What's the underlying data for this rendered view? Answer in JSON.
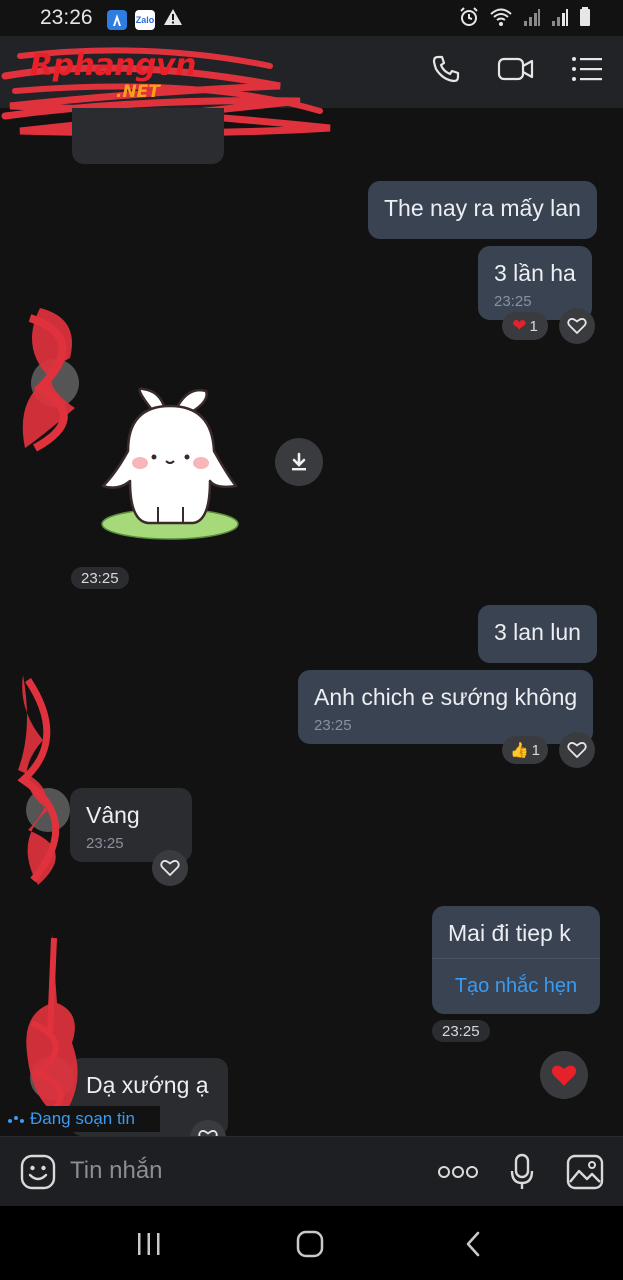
{
  "status_bar": {
    "time": "23:26",
    "left_icons": [
      "app-icon",
      "zalo-icon",
      "warning-icon"
    ],
    "zalo_label": "Zalo",
    "right_icons": [
      "alarm-icon",
      "wifi-icon",
      "signal-icon",
      "signal-icon",
      "battery-icon"
    ]
  },
  "header": {
    "watermark_brand": "Rphangvn",
    "watermark_suffix": ".NET",
    "actions": [
      "phone-icon",
      "video-call-icon",
      "menu-icon"
    ]
  },
  "messages": [
    {
      "id": "m1",
      "direction": "out",
      "text": "The nay ra mấy lan"
    },
    {
      "id": "m2",
      "direction": "out",
      "text": "3 lần ha",
      "time": "23:25",
      "reaction": {
        "emoji": "❤",
        "count": "1"
      }
    },
    {
      "id": "m3",
      "direction": "in",
      "type": "sticker",
      "sticker": "bunny-sticker",
      "time": "23:25"
    },
    {
      "id": "m4",
      "direction": "out",
      "text": "3 lan lun"
    },
    {
      "id": "m5",
      "direction": "out",
      "text": "Anh chich e sướng không",
      "time": "23:25",
      "reaction": {
        "emoji": "👍",
        "count": "1"
      }
    },
    {
      "id": "m6",
      "direction": "in",
      "text": "Vâng",
      "time": "23:25"
    },
    {
      "id": "m7",
      "direction": "out",
      "text": "Mai đi tiep k",
      "action": "Tạo nhắc hẹn",
      "time": "23:25"
    },
    {
      "id": "m8",
      "direction": "in",
      "text": "Dạ xướng ạ"
    }
  ],
  "typing_indicator": "Đang soạn tin",
  "composer": {
    "placeholder": "Tin nhắn",
    "icons": [
      "emoji-icon",
      "more-icon",
      "microphone-icon",
      "image-icon"
    ]
  },
  "nav": [
    "recents-icon",
    "home-icon",
    "back-icon"
  ],
  "colors": {
    "background": "#121213",
    "outgoing_bubble": "#3a4352",
    "incoming_bubble": "#2b2c2f",
    "link": "#3a9bf0",
    "heart": "#e8202a",
    "scribble": "#e0323d"
  }
}
